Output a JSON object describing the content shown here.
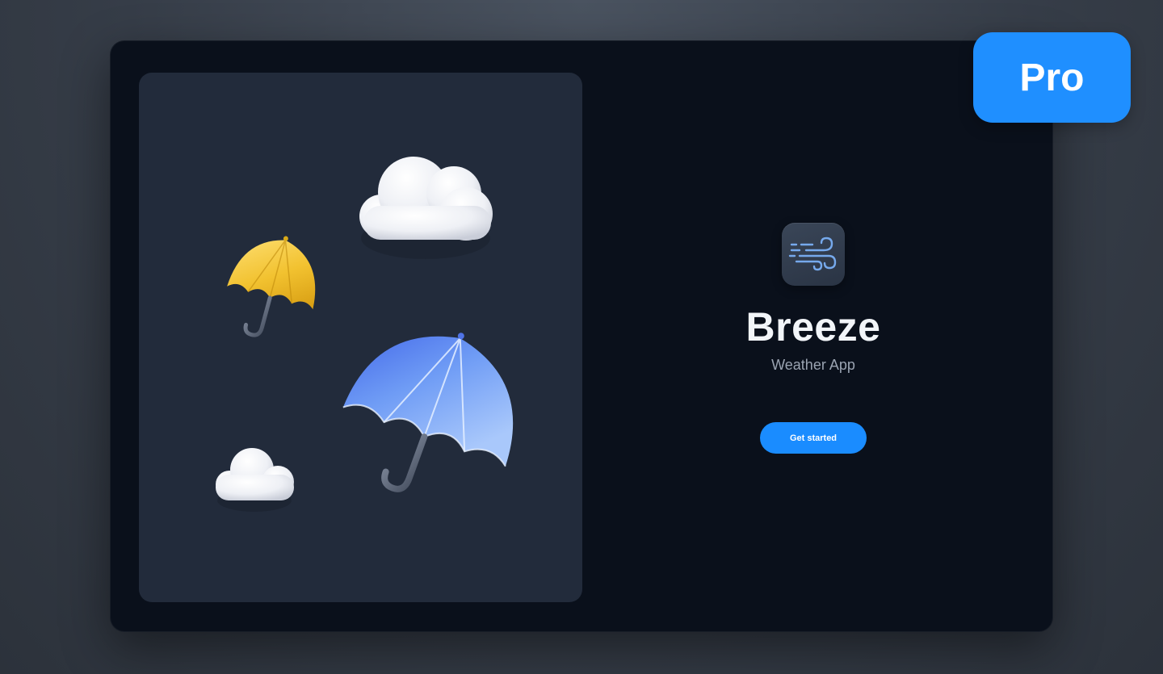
{
  "app": {
    "title": "Breeze",
    "subtitle": "Weather App",
    "icon": "wind-icon",
    "cta_label": "Get started"
  },
  "badge": {
    "label": "Pro"
  },
  "illustration": {
    "items": [
      "cloud-icon",
      "umbrella-icon",
      "umbrella-icon",
      "cloud-icon"
    ]
  },
  "colors": {
    "accent": "#1a8cff",
    "badge": "#1f8fff",
    "window_bg": "#0a101b",
    "panel_bg": "#222b3b",
    "title_text": "#f2f5f9",
    "subtitle_text": "#9aa3b1",
    "umbrella_yellow": "#f2c230",
    "umbrella_blue": "#4c7cf0"
  }
}
